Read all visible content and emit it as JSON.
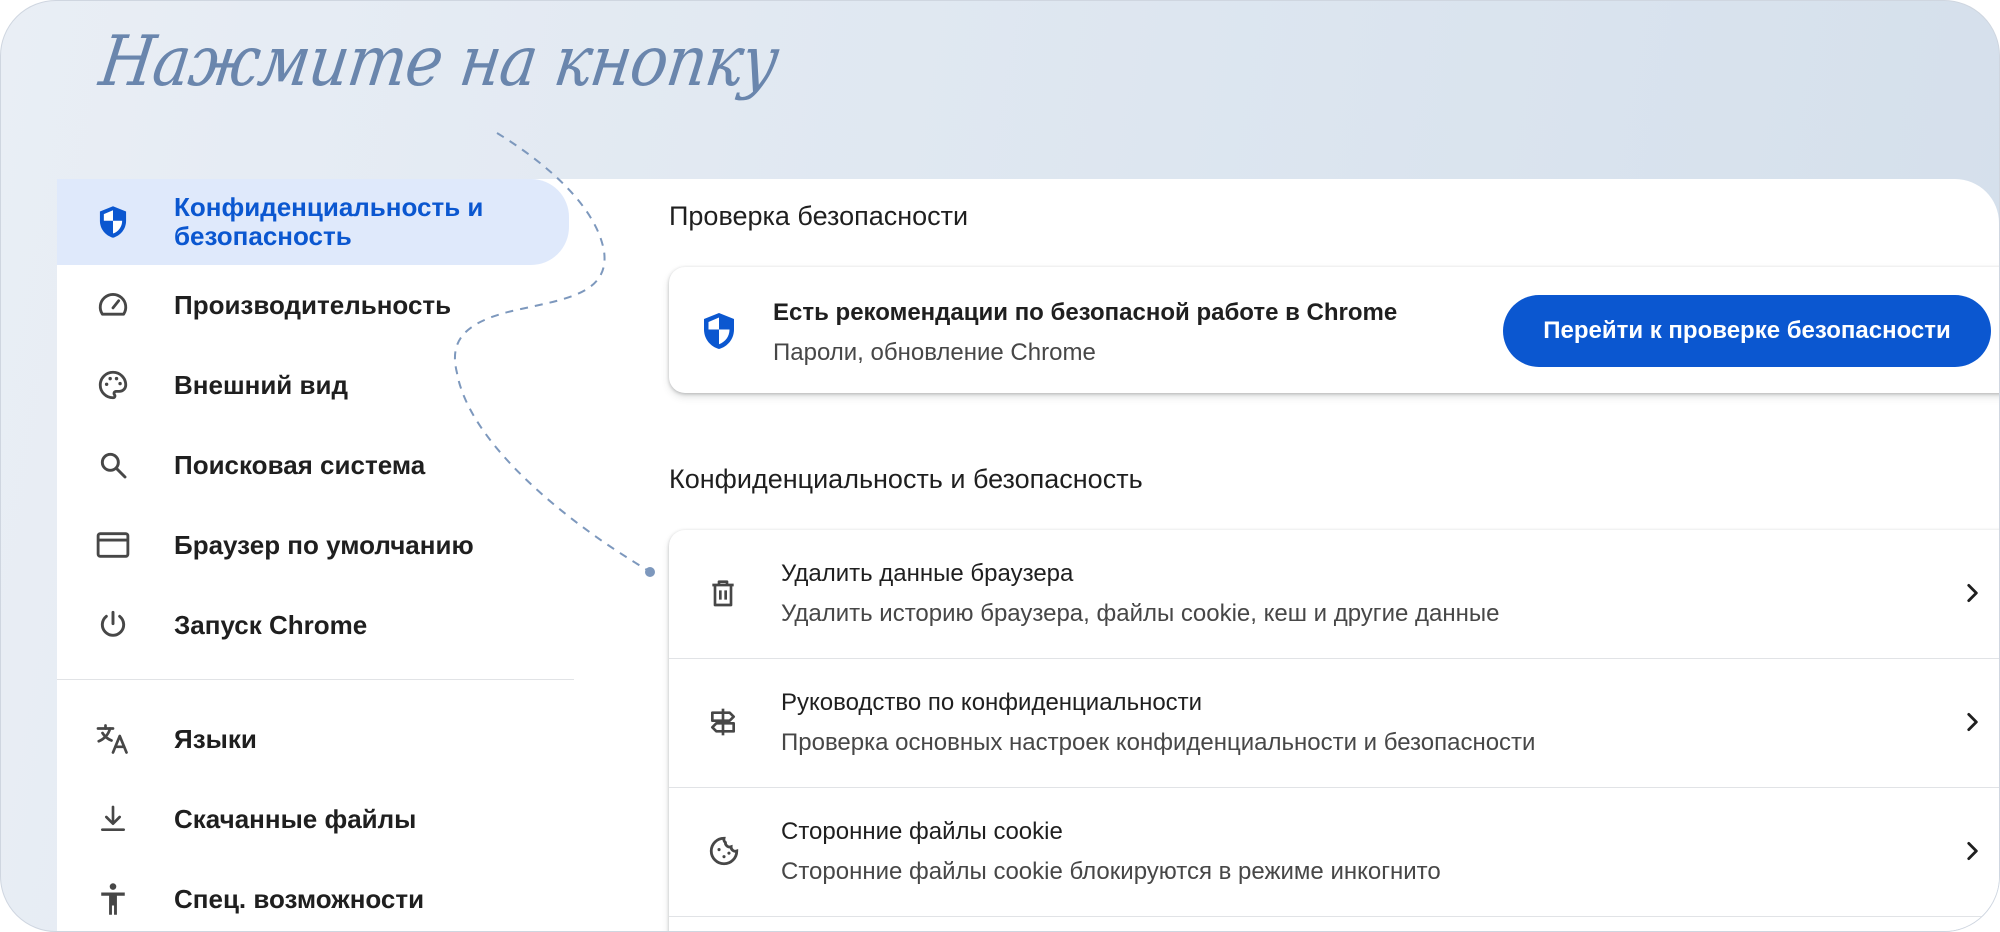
{
  "heading": "Нажмите на кнопку",
  "sidebar": {
    "items": [
      {
        "label": "Конфиденциальность и безопасность",
        "icon": "shield-icon",
        "active": true
      },
      {
        "label": "Производительность",
        "icon": "speedometer-icon"
      },
      {
        "label": "Внешний вид",
        "icon": "palette-icon"
      },
      {
        "label": "Поисковая система",
        "icon": "search-icon"
      },
      {
        "label": "Браузер по умолчанию",
        "icon": "browser-window-icon"
      },
      {
        "label": "Запуск Chrome",
        "icon": "power-icon"
      },
      {
        "label": "Языки",
        "icon": "translate-icon"
      },
      {
        "label": "Скачанные файлы",
        "icon": "download-icon"
      },
      {
        "label": "Спец. возможности",
        "icon": "accessibility-icon"
      }
    ]
  },
  "main": {
    "safety_check": {
      "title": "Проверка безопасности",
      "card_title": "Есть рекомендации по безопасной работе в Chrome",
      "card_subtitle": "Пароли, обновление Chrome",
      "button_label": "Перейти к проверке безопасности"
    },
    "privacy": {
      "title": "Конфиденциальность и безопасность",
      "rows": [
        {
          "title": "Удалить данные браузера",
          "subtitle": "Удалить историю браузера, файлы cookie, кеш и другие данные",
          "icon": "trash-icon"
        },
        {
          "title": "Руководство по конфиденциальности",
          "subtitle": "Проверка основных настроек конфиденциальности и безопасности",
          "icon": "signpost-icon"
        },
        {
          "title": "Сторонние файлы cookie",
          "subtitle": "Сторонние файлы cookie блокируются в режиме инкогнито",
          "icon": "cookie-icon"
        }
      ]
    }
  },
  "colors": {
    "accent": "#0b57d0",
    "active_nav_bg": "#dfe9fb",
    "callout": "#6a86ad"
  }
}
